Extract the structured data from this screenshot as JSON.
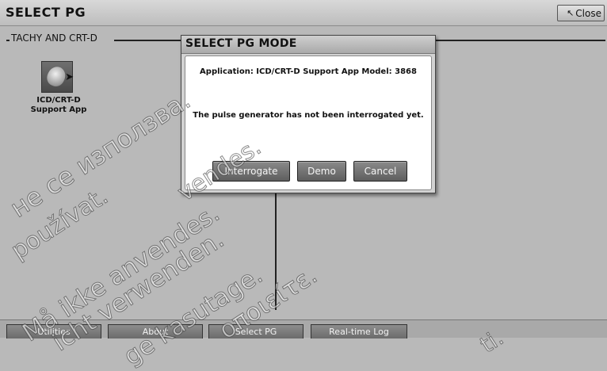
{
  "window": {
    "title": "SELECT PG",
    "close_label": "Close"
  },
  "group": {
    "label": "TACHY AND CRT-D",
    "app": {
      "label_line1": "ICD/CRT-D",
      "label_line2": "Support App",
      "icon": "pulse-generator-icon"
    }
  },
  "dialog": {
    "title": "SELECT PG MODE",
    "application_text": "Application: ICD/CRT-D Support App Model: 3868",
    "status_text": "The pulse generator has not been interrogated yet.",
    "buttons": {
      "interrogate": "Interrogate",
      "demo": "Demo",
      "cancel": "Cancel"
    }
  },
  "bottom_tabs": [
    {
      "label": "Utilities"
    },
    {
      "label": "About"
    },
    {
      "label": "Select PG"
    },
    {
      "label": "Real-time Log"
    }
  ],
  "watermark": {
    "lines": [
      "не се използва.",
      "používat.",
      "vendes.",
      "Må ikke anvendes.",
      "icht verwenden.",
      "ge kasutage.",
      "οποιείτε.",
      "ti."
    ]
  }
}
